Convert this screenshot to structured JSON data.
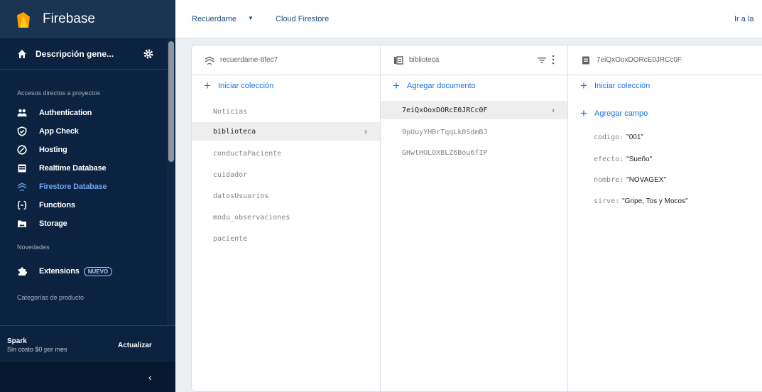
{
  "app": {
    "title": "Firebase",
    "overview_label": "Descripción gene...",
    "section_shortcuts": "Accesos directos a proyectos",
    "section_news": "Novedades",
    "section_categories": "Categorías de producto",
    "nav_items": [
      {
        "label": "Authentication",
        "icon": "people-icon"
      },
      {
        "label": "App Check",
        "icon": "shield-check-icon"
      },
      {
        "label": "Hosting",
        "icon": "hosting-icon"
      },
      {
        "label": "Realtime Database",
        "icon": "database-icon"
      },
      {
        "label": "Firestore Database",
        "icon": "firestore-icon"
      },
      {
        "label": "Functions",
        "icon": "functions-icon"
      },
      {
        "label": "Storage",
        "icon": "storage-icon"
      }
    ],
    "extensions_label": "Extensions",
    "extensions_badge": "NUEVO",
    "plan_name": "Spark",
    "plan_desc": "Sin costo $0 por mes",
    "upgrade_label": "Actualizar",
    "collapse_glyph": "‹"
  },
  "topbar": {
    "project": "Recuerdame",
    "caret": "▼",
    "product": "Cloud Firestore",
    "goto": "Ir a la"
  },
  "firestore": {
    "root": {
      "header": "recuerdame-8fec7",
      "add_label": "Iniciar colección",
      "collections": [
        "Noticias",
        "biblioteca",
        "conductaPaciente",
        "cuidador",
        "datosUsuarios",
        "modu_observaciones",
        "paciente"
      ],
      "selected": "biblioteca"
    },
    "collection": {
      "header": "biblioteca",
      "add_label": "Agregar documento",
      "documents": [
        "7eiQxOoxDORcE0JRCc0F",
        "9pUuyYHBrTqqLk0SdmBJ",
        "GHwtHOLOXBLZ6Bou6fIP"
      ],
      "selected": "7eiQxOoxDORcE0JRCc0F"
    },
    "document": {
      "header": "7eiQxOoxDORcE0JRCc0F",
      "add_collection_label": "Iniciar colección",
      "add_field_label": "Agregar campo",
      "fields": [
        {
          "key": "codigo:",
          "value": "\"001\""
        },
        {
          "key": "efecto:",
          "value": "\"Sueño\""
        },
        {
          "key": "nombre:",
          "value": "\"NOVAGEX\""
        },
        {
          "key": "sirve:",
          "value": "\"Gripe, Tos y Mocos\""
        }
      ]
    }
  },
  "colors": {
    "sidebar_bg": "#0b2240",
    "accent_blue": "#1a73e8",
    "active_nav": "#6fa6ee"
  }
}
